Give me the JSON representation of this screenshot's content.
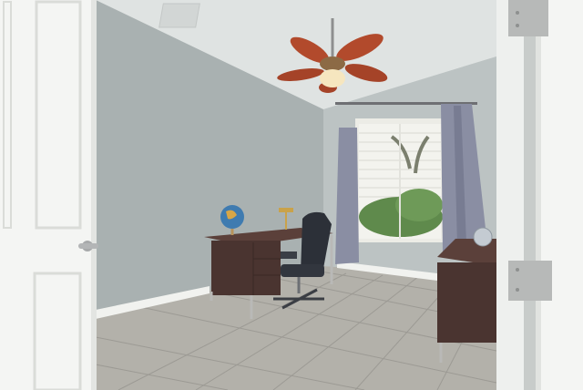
{
  "scene": {
    "description_free": true,
    "colors": {
      "wall_left": "#a9b1b1",
      "wall_back": "#bcc3c3",
      "ceiling": "#dfe3e2",
      "floor": "#b3b1aa",
      "grout": "#9c9a94",
      "door": "#f4f5f3",
      "trim": "#f1f2ef",
      "curtain": "#8a8ea3",
      "desk": "#4a3430",
      "desk_top": "#5b403a",
      "chair": "#2c3038",
      "fan_blade": "#b24a2c",
      "window_light": "#f3f3ee",
      "foliage": "#5f8a4c",
      "hinge": "#b7b9b8"
    }
  }
}
